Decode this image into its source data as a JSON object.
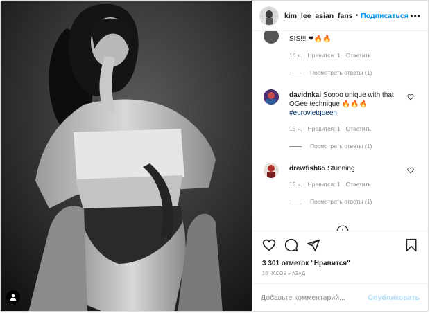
{
  "header": {
    "username": "kim_lee_asian_fans",
    "separator": "•",
    "follow_label": "Подписаться",
    "more_label": "•••"
  },
  "comments": [
    {
      "text": "SIS!!! ❤🔥🔥",
      "time": "16 ч.",
      "likes": "Нравится: 1",
      "reply": "Ответить",
      "view_replies": "Посмотреть ответы (1)"
    },
    {
      "username": "davidnkai",
      "text": "Soooo unique with that OGee technique 🔥🔥🔥",
      "hashtag": "#eurovietqueen",
      "time": "15 ч.",
      "likes": "Нравится: 1",
      "reply": "Ответить",
      "view_replies": "Посмотреть ответы (1)"
    },
    {
      "username": "drewfish65",
      "text": "Stunning",
      "time": "13 ч.",
      "likes": "Нравится: 1",
      "reply": "Ответить",
      "view_replies": "Посмотреть ответы (1)"
    }
  ],
  "likes_text": "3 301 отметок \"Нравится\"",
  "timestamp": "16 ЧАСОВ НАЗАД",
  "add_comment": {
    "placeholder": "Добавьте комментарий...",
    "publish_label": "Опубликовать"
  },
  "colors": {
    "follow": "#0095f6",
    "hashtag": "#00376b",
    "heart": "#ed4956",
    "publish_disabled": "#b2dffc"
  }
}
